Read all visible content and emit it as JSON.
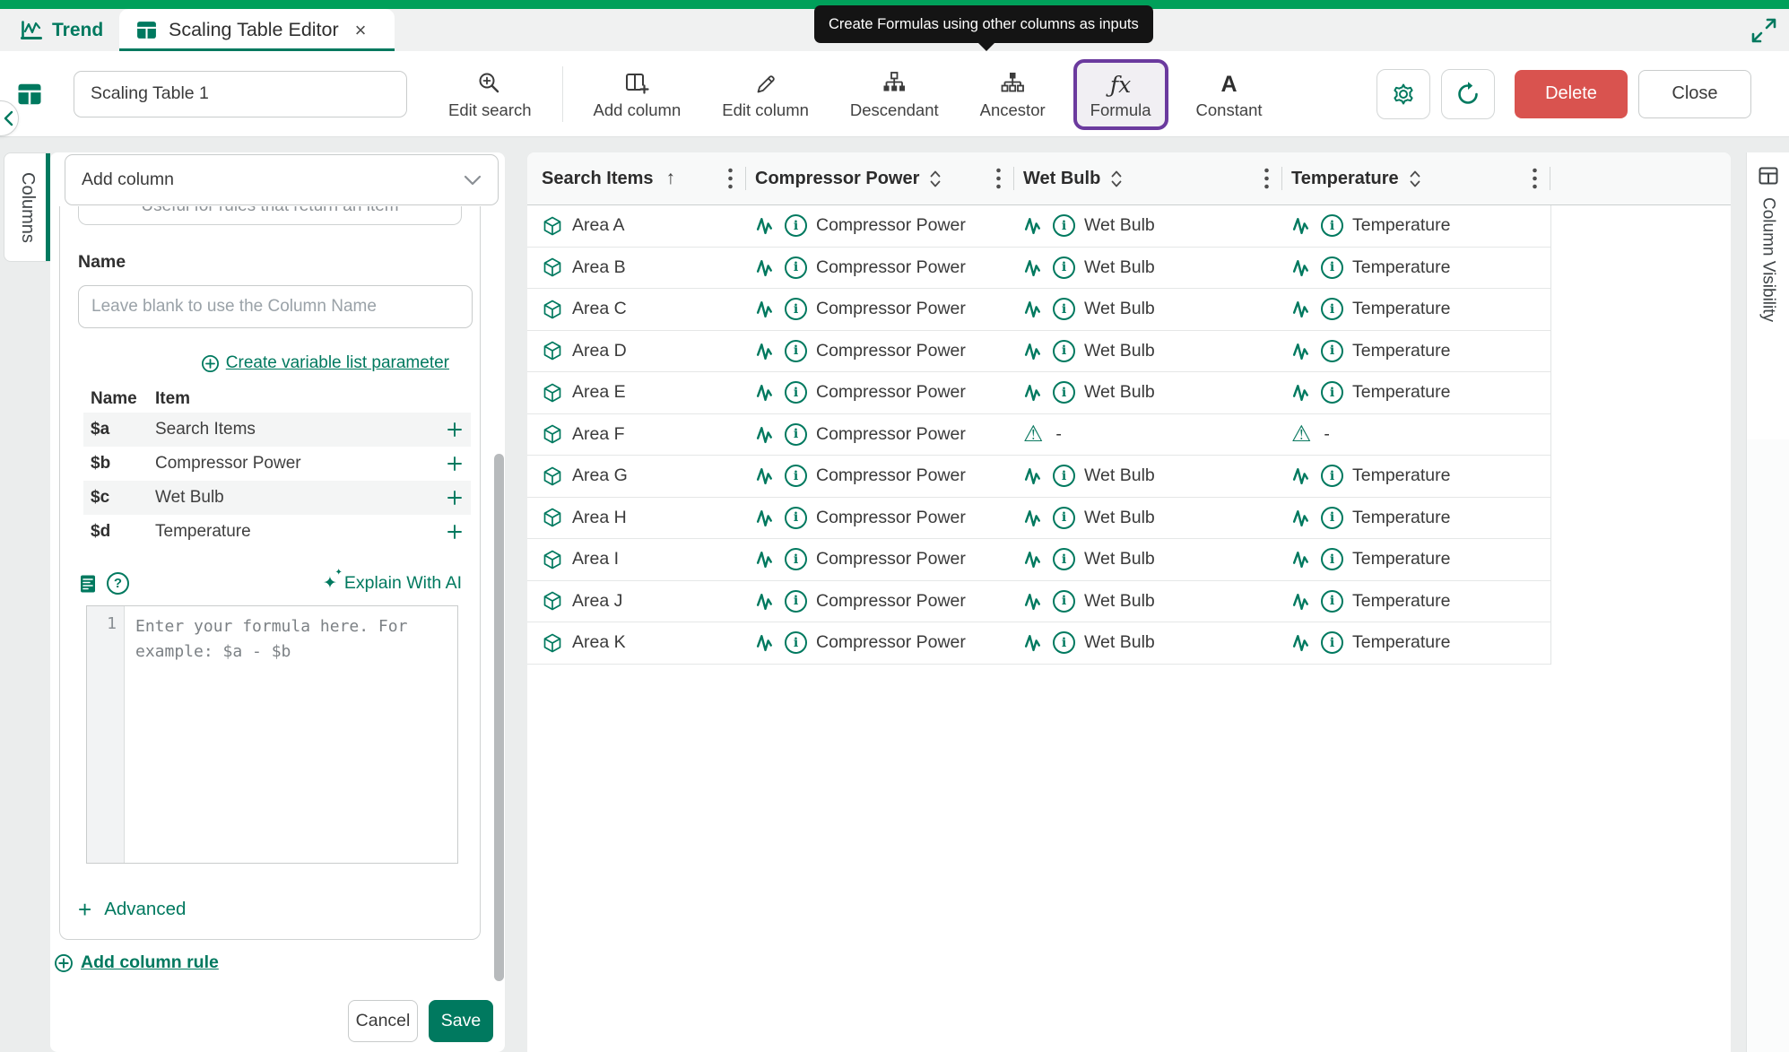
{
  "tabs": [
    {
      "label": "Trend",
      "active": false
    },
    {
      "label": "Scaling Table Editor",
      "active": true,
      "closable": true
    }
  ],
  "tooltip": {
    "text": "Create Formulas using other columns as inputs"
  },
  "toolbar": {
    "table_name": "Scaling Table 1",
    "items": [
      {
        "label": "Edit search"
      },
      {
        "label": "Add column"
      },
      {
        "label": "Edit column"
      },
      {
        "label": "Descendant"
      },
      {
        "label": "Ancestor"
      },
      {
        "label": "Formula"
      },
      {
        "label": "Constant"
      }
    ],
    "delete_label": "Delete",
    "close_label": "Close"
  },
  "sidebar": {
    "tab_label": "Columns",
    "add_column_label": "Add column",
    "clipped_hint": "Useful for rules that return an item",
    "name_label": "Name",
    "name_placeholder": "Leave blank to use the Column Name",
    "create_param_link": "Create variable list parameter",
    "param_table": {
      "name_header": "Name",
      "item_header": "Item",
      "rows": [
        {
          "name": "$a",
          "item": "Search Items"
        },
        {
          "name": "$b",
          "item": "Compressor Power"
        },
        {
          "name": "$c",
          "item": "Wet Bulb"
        },
        {
          "name": "$d",
          "item": "Temperature"
        }
      ]
    },
    "explain_ai_label": "Explain With AI",
    "formula_editor": {
      "line_number": "1",
      "placeholder": "Enter your formula here. For example: $a - $b"
    },
    "advanced_label": "Advanced",
    "add_column_rule_label": "Add column rule",
    "cancel_label": "Cancel",
    "save_label": "Save"
  },
  "table": {
    "headers": [
      {
        "label": "Search Items",
        "sort": "asc"
      },
      {
        "label": "Compressor Power",
        "sort": "none"
      },
      {
        "label": "Wet Bulb",
        "sort": "none"
      },
      {
        "label": "Temperature",
        "sort": "none"
      }
    ],
    "rows": [
      {
        "name": "Area A",
        "cells": [
          {
            "label": "Compressor Power"
          },
          {
            "label": "Wet Bulb"
          },
          {
            "label": "Temperature"
          }
        ]
      },
      {
        "name": "Area B",
        "cells": [
          {
            "label": "Compressor Power"
          },
          {
            "label": "Wet Bulb"
          },
          {
            "label": "Temperature"
          }
        ]
      },
      {
        "name": "Area C",
        "cells": [
          {
            "label": "Compressor Power"
          },
          {
            "label": "Wet Bulb"
          },
          {
            "label": "Temperature"
          }
        ]
      },
      {
        "name": "Area D",
        "cells": [
          {
            "label": "Compressor Power"
          },
          {
            "label": "Wet Bulb"
          },
          {
            "label": "Temperature"
          }
        ]
      },
      {
        "name": "Area E",
        "cells": [
          {
            "label": "Compressor Power"
          },
          {
            "label": "Wet Bulb"
          },
          {
            "label": "Temperature"
          }
        ]
      },
      {
        "name": "Area F",
        "cells": [
          {
            "label": "Compressor Power"
          },
          {
            "label": "-",
            "missing": true
          },
          {
            "label": "-",
            "missing": true
          }
        ]
      },
      {
        "name": "Area G",
        "cells": [
          {
            "label": "Compressor Power"
          },
          {
            "label": "Wet Bulb"
          },
          {
            "label": "Temperature"
          }
        ]
      },
      {
        "name": "Area H",
        "cells": [
          {
            "label": "Compressor Power"
          },
          {
            "label": "Wet Bulb"
          },
          {
            "label": "Temperature"
          }
        ]
      },
      {
        "name": "Area I",
        "cells": [
          {
            "label": "Compressor Power"
          },
          {
            "label": "Wet Bulb"
          },
          {
            "label": "Temperature"
          }
        ]
      },
      {
        "name": "Area J",
        "cells": [
          {
            "label": "Compressor Power"
          },
          {
            "label": "Wet Bulb"
          },
          {
            "label": "Temperature"
          }
        ]
      },
      {
        "name": "Area K",
        "cells": [
          {
            "label": "Compressor Power"
          },
          {
            "label": "Wet Bulb"
          },
          {
            "label": "Temperature"
          }
        ]
      }
    ]
  },
  "right_panel": {
    "tab_label": "Column Visibility"
  },
  "colors": {
    "accent_green": "#00795f",
    "topbar_green": "#00a05a",
    "delete_red": "#d9534f",
    "formula_highlight_purple": "#6b3a9e",
    "tooltip_bg": "#141414"
  }
}
